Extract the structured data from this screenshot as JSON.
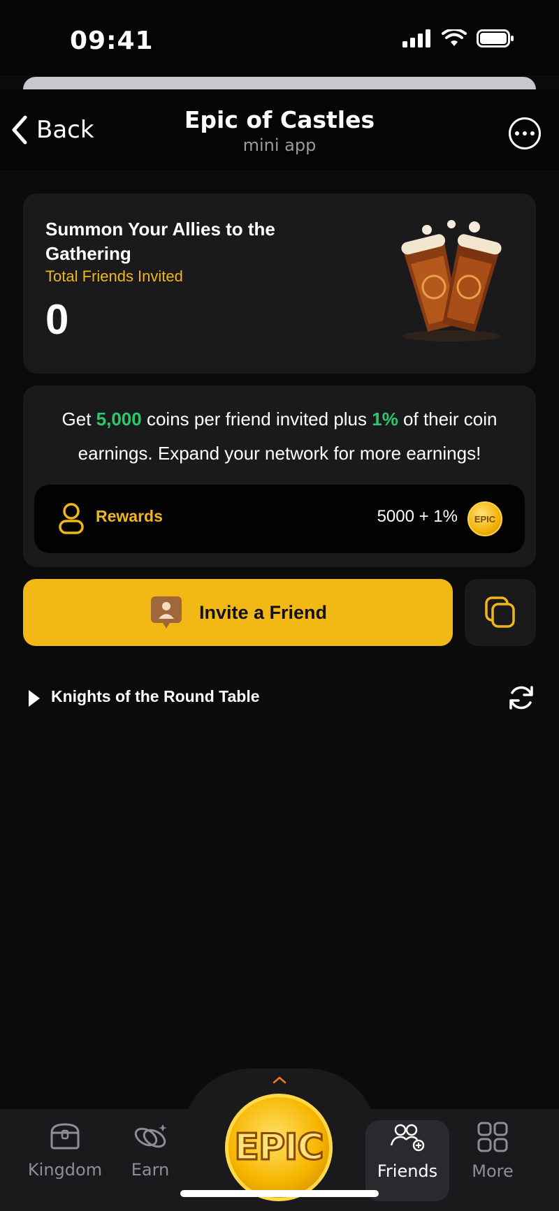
{
  "status": {
    "time": "09:41"
  },
  "nav": {
    "back_label": "Back",
    "title": "Epic of Castles",
    "subtitle": "mini app"
  },
  "summary_card": {
    "title": "Summon Your Allies to the Gathering",
    "subtitle": "Total Friends Invited",
    "count": "0"
  },
  "promo": {
    "part1": "Get ",
    "coins": "5,000",
    "part2": " coins per friend invited plus ",
    "percent": "1%",
    "part3": " of their coin earnings. Expand your network for more earnings!"
  },
  "rewards": {
    "label": "Rewards",
    "value": "5000   + 1%",
    "coin_label": "EPIC"
  },
  "invite": {
    "label": "Invite a Friend"
  },
  "section": {
    "title": "Knights of the Round Table"
  },
  "tabs": {
    "kingdom": "Kingdom",
    "earn": "Earn",
    "center": "EPIC",
    "friends": "Friends",
    "more": "More"
  },
  "colors": {
    "accent": "#f2b916",
    "green": "#2ec76a",
    "card": "#1a1a1d"
  }
}
